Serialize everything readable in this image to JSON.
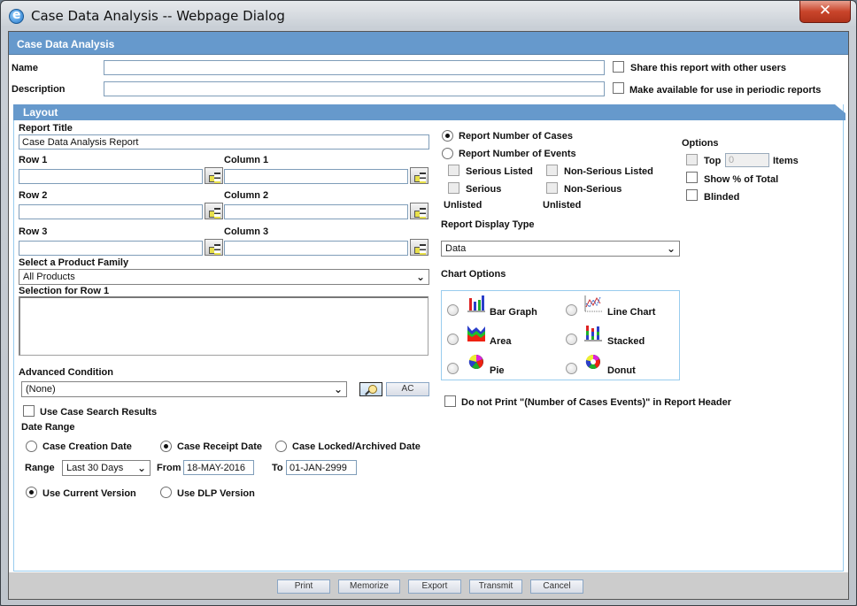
{
  "window": {
    "title": "Case Data Analysis -- Webpage Dialog",
    "close_icon": "close-x-icon"
  },
  "header": {
    "title": "Case Data Analysis"
  },
  "form": {
    "name_label": "Name",
    "name_value": "",
    "description_label": "Description",
    "description_value": "",
    "share_label": "Share this report with other users",
    "share_checked": false,
    "periodic_label": "Make available for use in periodic reports",
    "periodic_checked": false
  },
  "layout": {
    "section_title": "Layout",
    "report_title_label": "Report Title",
    "report_title_value": "Case Data Analysis Report",
    "rows": [
      {
        "row_label": "Row 1",
        "row_value": "",
        "col_label": "Column 1",
        "col_value": ""
      },
      {
        "row_label": "Row 2",
        "row_value": "",
        "col_label": "Column 2",
        "col_value": ""
      },
      {
        "row_label": "Row 3",
        "row_value": "",
        "col_label": "Column 3",
        "col_value": ""
      }
    ],
    "product_family_label": "Select a Product Family",
    "product_family_value": "All Products",
    "selection_label": "Selection for Row 1",
    "advanced_condition_label": "Advanced Condition",
    "advanced_condition_value": "(None)",
    "ac_button": "AC",
    "use_case_search_label": "Use Case Search Results",
    "date_range_label": "Date Range",
    "date_types": [
      {
        "label": "Case Creation Date",
        "selected": false
      },
      {
        "label": "Case Receipt Date",
        "selected": true
      },
      {
        "label": "Case Locked/Archived Date",
        "selected": false
      }
    ],
    "range_label": "Range",
    "range_value": "Last 30 Days",
    "from_label": "From",
    "from_value": "18-MAY-2016",
    "to_label": "To",
    "to_value": "01-JAN-2999",
    "versions": [
      {
        "label": "Use Current Version",
        "selected": true
      },
      {
        "label": "Use DLP Version",
        "selected": false
      }
    ]
  },
  "report_count": {
    "cases_label": "Report Number of Cases",
    "cases_selected": true,
    "events_label": "Report Number of Events",
    "events_selected": false,
    "serious_listed": "Serious Listed",
    "non_serious_listed": "Non-Serious Listed",
    "serious": "Serious",
    "non_serious": "Non-Serious",
    "unlisted_1": "Unlisted",
    "unlisted_2": "Unlisted"
  },
  "options": {
    "title": "Options",
    "top_label": "Top",
    "top_value": "0",
    "items_label": "Items",
    "show_pct_label": "Show % of Total",
    "blinded_label": "Blinded"
  },
  "display": {
    "type_label": "Report Display Type",
    "type_value": "Data",
    "chart_options_label": "Chart Options",
    "chart_types": [
      {
        "label": "Bar Graph",
        "icon": "bar-graph-icon"
      },
      {
        "label": "Line Chart",
        "icon": "line-chart-icon"
      },
      {
        "label": "Area",
        "icon": "area-chart-icon"
      },
      {
        "label": "Stacked",
        "icon": "stacked-chart-icon"
      },
      {
        "label": "Pie",
        "icon": "pie-chart-icon"
      },
      {
        "label": "Donut",
        "icon": "donut-chart-icon"
      }
    ],
    "do_not_print_label": "Do not Print \"(Number of Cases Events)\" in Report Header"
  },
  "footer": {
    "buttons": [
      "Print",
      "Memorize",
      "Export",
      "Transmit",
      "Cancel"
    ]
  }
}
